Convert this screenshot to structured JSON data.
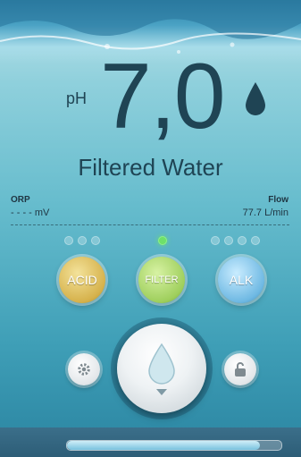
{
  "reading": {
    "ph_label": "pH",
    "ph_value": "7,0",
    "status": "Filtered Water"
  },
  "orp": {
    "title": "ORP",
    "value": "- - - - mV"
  },
  "flow": {
    "title": "Flow",
    "value": "77.7 L/min"
  },
  "modes": {
    "acid_label": "ACID",
    "filter_label": "FILTER",
    "alk_label": "ALK",
    "active": "FILTER",
    "acid_levels": 3,
    "alk_levels": 4
  },
  "icons": {
    "drop": "water-drop-icon",
    "settings": "gear-icon",
    "lock": "lock-icon",
    "main": "water-drop-dispense-icon"
  },
  "progress": {
    "fraction": 0.9
  },
  "colors": {
    "text": "#1f4454",
    "active_indicator": "#6ee06a",
    "acid": "#d6b24c",
    "filter": "#9fcf5d",
    "alk": "#6fb9e3"
  }
}
